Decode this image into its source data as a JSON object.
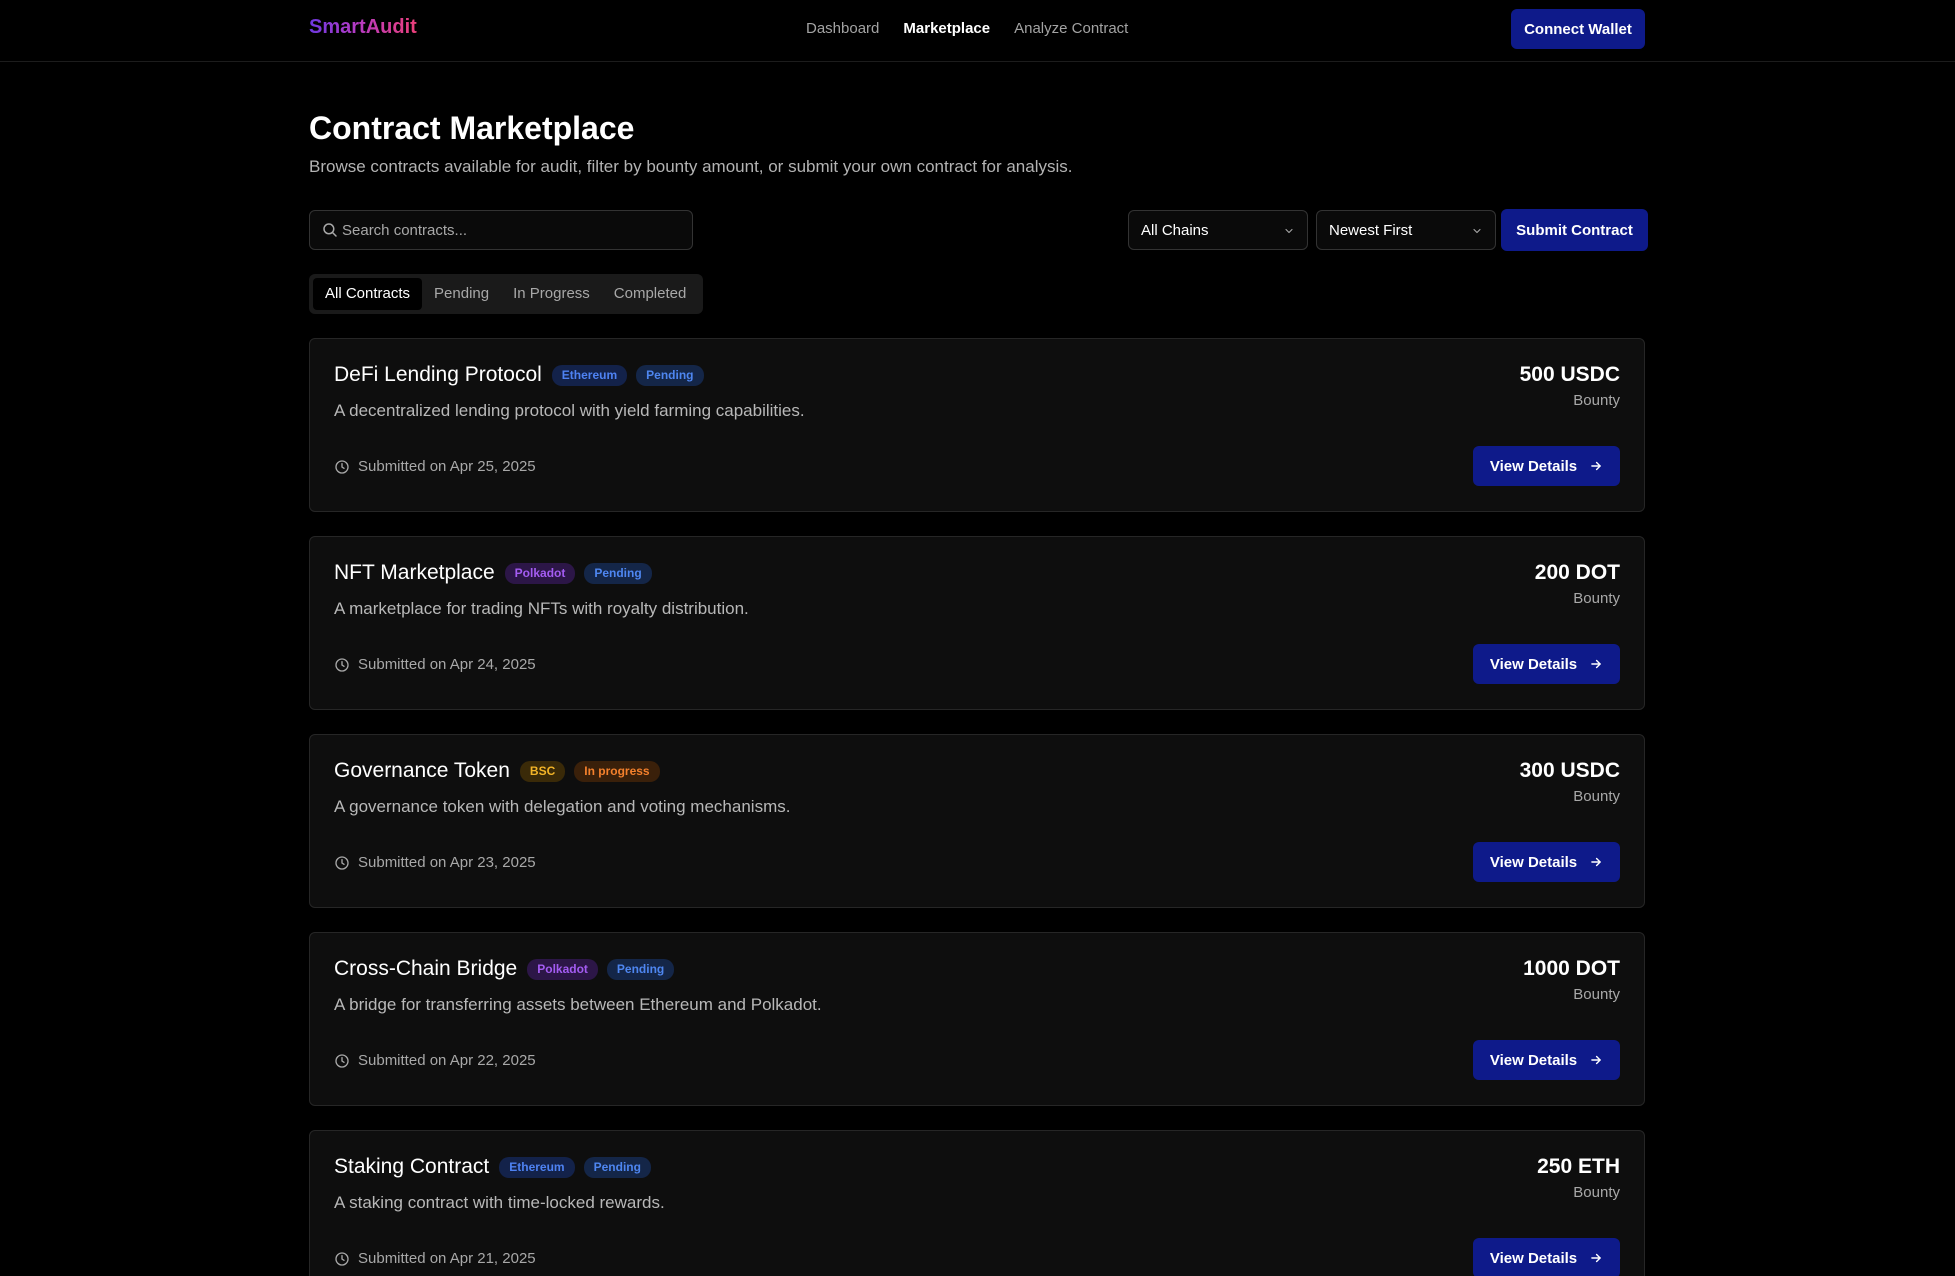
{
  "nav": {
    "logo": "SmartAudit",
    "links": [
      "Dashboard",
      "Marketplace",
      "Analyze Contract"
    ],
    "active_link": "Marketplace",
    "connect_wallet": "Connect Wallet"
  },
  "page": {
    "title": "Contract Marketplace",
    "subtitle": "Browse contracts available for audit, filter by bounty amount, or submit your own contract for analysis."
  },
  "filters": {
    "search_placeholder": "Search contracts...",
    "chain_select": "All Chains",
    "sort_select": "Newest First",
    "submit_button": "Submit Contract"
  },
  "tabs": [
    "All Contracts",
    "Pending",
    "In Progress",
    "Completed"
  ],
  "active_tab": "All Contracts",
  "contracts": [
    {
      "title": "DeFi Lending Protocol",
      "chain": "Ethereum",
      "status": "Pending",
      "description": "A decentralized lending protocol with yield farming capabilities.",
      "submitted": "Submitted on Apr 25, 2025",
      "bounty": "500 USDC",
      "bounty_label": "Bounty",
      "action": "View Details"
    },
    {
      "title": "NFT Marketplace",
      "chain": "Polkadot",
      "status": "Pending",
      "description": "A marketplace for trading NFTs with royalty distribution.",
      "submitted": "Submitted on Apr 24, 2025",
      "bounty": "200 DOT",
      "bounty_label": "Bounty",
      "action": "View Details"
    },
    {
      "title": "Governance Token",
      "chain": "BSC",
      "status": "In progress",
      "description": "A governance token with delegation and voting mechanisms.",
      "submitted": "Submitted on Apr 23, 2025",
      "bounty": "300 USDC",
      "bounty_label": "Bounty",
      "action": "View Details"
    },
    {
      "title": "Cross-Chain Bridge",
      "chain": "Polkadot",
      "status": "Pending",
      "description": "A bridge for transferring assets between Ethereum and Polkadot.",
      "submitted": "Submitted on Apr 22, 2025",
      "bounty": "1000 DOT",
      "bounty_label": "Bounty",
      "action": "View Details"
    },
    {
      "title": "Staking Contract",
      "chain": "Ethereum",
      "status": "Pending",
      "description": "A staking contract with time-locked rewards.",
      "submitted": "Submitted on Apr 21, 2025",
      "bounty": "250 ETH",
      "bounty_label": "Bounty",
      "action": "View Details"
    }
  ],
  "colors": {
    "background": "#000000",
    "card_bg": "#0e0e0e",
    "primary_button": "#0e1a8a",
    "badge_ethereum": "#4e82f2",
    "badge_polkadot": "#a45cf2",
    "badge_bsc": "#f2b428",
    "badge_pending": "#4e86f0",
    "badge_in_progress": "#f4802c"
  },
  "icons": {
    "search": "search-icon",
    "chevron": "chevron-down-icon",
    "clock": "clock-icon",
    "arrow": "arrow-right-icon"
  }
}
